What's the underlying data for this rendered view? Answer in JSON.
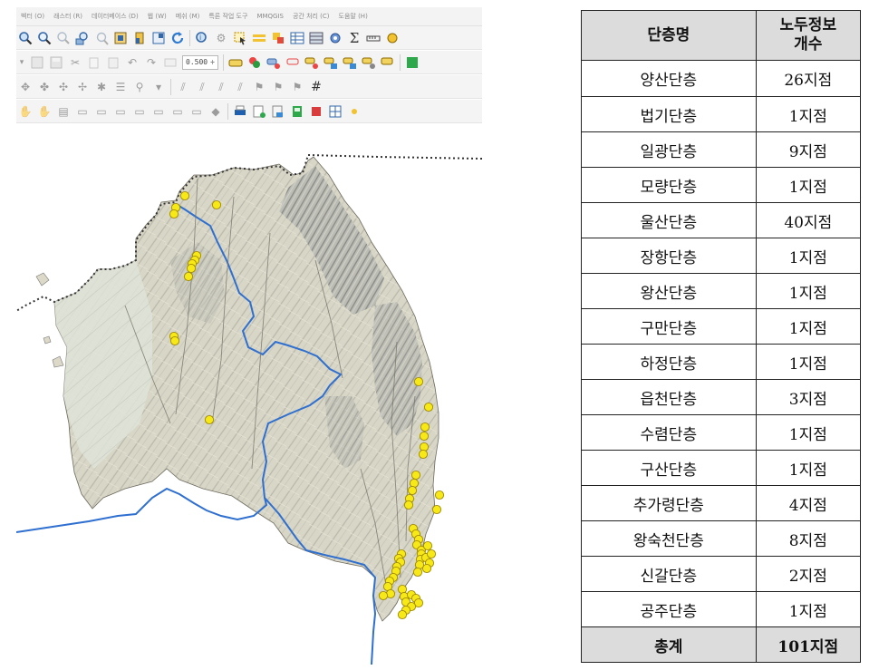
{
  "qgis": {
    "menu": [
      "벡터 (O)",
      "래스터 (R)",
      "데이터베이스 (D)",
      "웹 (W)",
      "메쉬 (M)",
      "특론 작업 도구",
      "MMQGIS",
      "공간 처리 (C)",
      "도움말 (H)"
    ],
    "toolbar": {
      "scale_value": "0.500",
      "scale_spin": "÷"
    },
    "icons": [
      "pan-icon",
      "zoom-in-icon",
      "zoom-out-icon",
      "zoom-full-icon",
      "refresh-icon",
      "identify-icon",
      "select-icon",
      "attribute-table-icon",
      "sum-icon",
      "measure-icon",
      "grid-icon"
    ],
    "map": {
      "colors": {
        "sea": "#ffffff",
        "land": "#dcd9c8",
        "terrain_dark": "#8f8e86",
        "boundary": "#2f6fd0",
        "coast": "#3a3a3a",
        "point_fill": "#f7e817",
        "point_stroke": "#a08a00"
      },
      "point_count": 58
    }
  },
  "table": {
    "headers": {
      "name": "단층명",
      "count_line1": "노두정보",
      "count_line2": "개수"
    },
    "rows": [
      {
        "name": "양산단층",
        "count": "26지점"
      },
      {
        "name": "법기단층",
        "count": "1지점"
      },
      {
        "name": "일광단층",
        "count": "9지점"
      },
      {
        "name": "모량단층",
        "count": "1지점"
      },
      {
        "name": "울산단층",
        "count": "40지점"
      },
      {
        "name": "장항단층",
        "count": "1지점"
      },
      {
        "name": "왕산단층",
        "count": "1지점"
      },
      {
        "name": "구만단층",
        "count": "1지점"
      },
      {
        "name": "하정단층",
        "count": "1지점"
      },
      {
        "name": "읍천단층",
        "count": "3지점"
      },
      {
        "name": "수렴단층",
        "count": "1지점"
      },
      {
        "name": "구산단층",
        "count": "1지점"
      },
      {
        "name": "추가령단층",
        "count": "4지점"
      },
      {
        "name": "왕숙천단층",
        "count": "8지점"
      },
      {
        "name": "신갈단층",
        "count": "2지점"
      },
      {
        "name": "공주단층",
        "count": "1지점"
      }
    ],
    "total": {
      "label": "총계",
      "count": "101지점"
    }
  }
}
